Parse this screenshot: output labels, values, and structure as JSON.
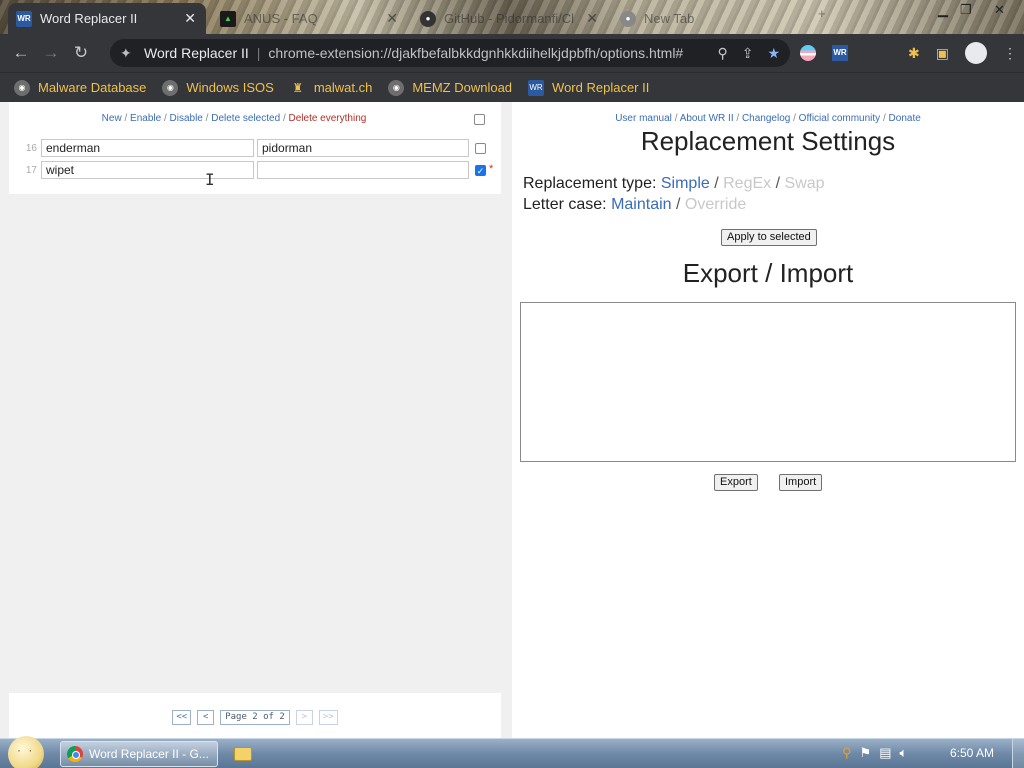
{
  "browser": {
    "tabs": [
      {
        "title": "Word Replacer II",
        "active": true
      },
      {
        "title": "ANUS - FAQ",
        "active": false
      },
      {
        "title": "GitHub - Pidormanfi/Cl",
        "active": false
      },
      {
        "title": "New Tab",
        "active": false
      }
    ],
    "omnibox": {
      "page_title": "Word Replacer II",
      "url": "chrome-extension://djakfbefalbkkdgnhkkdiihelkjdpbfh/options.html#"
    },
    "bookmarks": [
      {
        "label": "Malware Database"
      },
      {
        "label": "Windows ISOS"
      },
      {
        "label": "malwat.ch"
      },
      {
        "label": "MEMZ Download"
      },
      {
        "label": "Word Replacer II"
      }
    ]
  },
  "left": {
    "actions": {
      "new": "New",
      "enable": "Enable",
      "disable": "Disable",
      "delete_selected": "Delete selected",
      "delete_everything": "Delete everything",
      "separator": "/"
    },
    "rows": [
      {
        "num": "16",
        "find": "enderman",
        "replace": "pidorman",
        "checked": false
      },
      {
        "num": "17",
        "find": "wipet",
        "replace": "",
        "checked": true,
        "modified_marker": "*"
      }
    ],
    "pager": {
      "first": "<<",
      "prev": "<",
      "label": "Page 2 of 2",
      "next": ">",
      "last": ">>"
    }
  },
  "right": {
    "links": {
      "manual": "User manual",
      "about": "About WR II",
      "changelog": "Changelog",
      "community": "Official community",
      "donate": "Donate",
      "separator": "/"
    },
    "settings_heading": "Replacement Settings",
    "replacement_type": {
      "label": "Replacement type:",
      "simple": "Simple",
      "regex": "RegEx",
      "swap": "Swap",
      "selected": "Simple"
    },
    "letter_case": {
      "label": "Letter case:",
      "maintain": "Maintain",
      "override": "Override",
      "selected": "Maintain"
    },
    "apply_button": "Apply to selected",
    "export_heading": "Export / Import",
    "export_text": "",
    "export_button": "Export",
    "import_button": "Import"
  },
  "taskbar": {
    "task_title": "Word Replacer II - G...",
    "clock": "6:50 AM"
  }
}
